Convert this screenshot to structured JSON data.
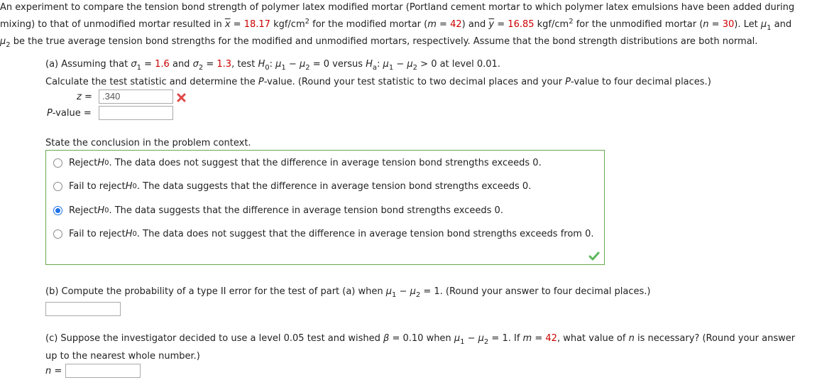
{
  "intro": {
    "l1": "An experiment to compare the tension bond strength of polymer latex modified mortar (Portland cement mortar to which polymer latex emulsions have been added during",
    "l2_a": "mixing) to that of unmodified mortar resulted in ",
    "xbar": "x",
    "eq": " = ",
    "x_value": "18.17",
    "unit": " kgf/cm",
    "sq": "2",
    "l2_b": " for the modified mortar (",
    "m_label": "m",
    "m_value": "42",
    "l2_c": ") and ",
    "ybar": "y",
    "y_value": "16.85",
    "l2_d": " for the unmodified mortar (",
    "n_label": "n",
    "n_value": "30",
    "l2_e": "). Let ",
    "mu": "μ",
    "one": "1",
    "two": "2",
    "and": " and",
    "l3": " be the true average tension bond strengths for the modified and unmodified mortars, respectively. Assume that the bond strength distributions are both normal."
  },
  "part_a": {
    "p1": "(a) Assuming that ",
    "sigma": "σ",
    "s1_value": "1.6",
    "and": " and ",
    "s2_value": "1.3",
    "p2": ", test ",
    "H": "H",
    "zero": "0",
    "a": "a",
    "p3": ": ",
    "minus": " − ",
    "p4": " = 0 versus ",
    "p5": " > 0 at level 0.01.",
    "instr_a": "Calculate the test statistic and determine the ",
    "P": "P",
    "instr_b": "-value. (Round your test statistic to two decimal places and your ",
    "instr_c": "-value to four decimal places.)",
    "z_label": "z",
    "eq": " = ",
    "z_value": ".340",
    "p_label_rest": "-value  =",
    "p_value": ""
  },
  "conclusion": {
    "prompt": "State the conclusion in the problem context.",
    "options": [
      {
        "pre": "Reject ",
        "post": ". The data does not suggest that the difference in average tension bond strengths exceeds 0.",
        "selected": false
      },
      {
        "pre": "Fail to reject ",
        "post": ". The data suggests that the difference in average tension bond strengths exceeds 0.",
        "selected": false
      },
      {
        "pre": "Reject ",
        "post": ". The data suggests that the difference in average tension bond strengths exceeds 0.",
        "selected": true
      },
      {
        "pre": "Fail to reject ",
        "post": ". The data does not suggest that the difference in average tension bond strengths exceeds from 0.",
        "selected": false
      }
    ],
    "status": "correct"
  },
  "part_b": {
    "q1": "(b) Compute the probability of a type II error for the test of part (a) when ",
    "q2": " = 1. (Round your answer to four decimal places.)",
    "answer": ""
  },
  "part_c": {
    "q1": "(c) Suppose the investigator decided to use a level 0.05 test and wished ",
    "beta": "β",
    "q2": " = 0.10 when ",
    "q3": " = 1. If ",
    "m_value": "42",
    "q4": ", what value of ",
    "q5": " is necessary? (Round your answer",
    "q6": "up to the nearest whole number.)",
    "n_prompt_rest": " =",
    "answer": ""
  },
  "colors": {
    "highlight": "#cc0000",
    "correct": "#6aa84f",
    "wrong": "#e04848",
    "radio": "#1e73e8"
  }
}
